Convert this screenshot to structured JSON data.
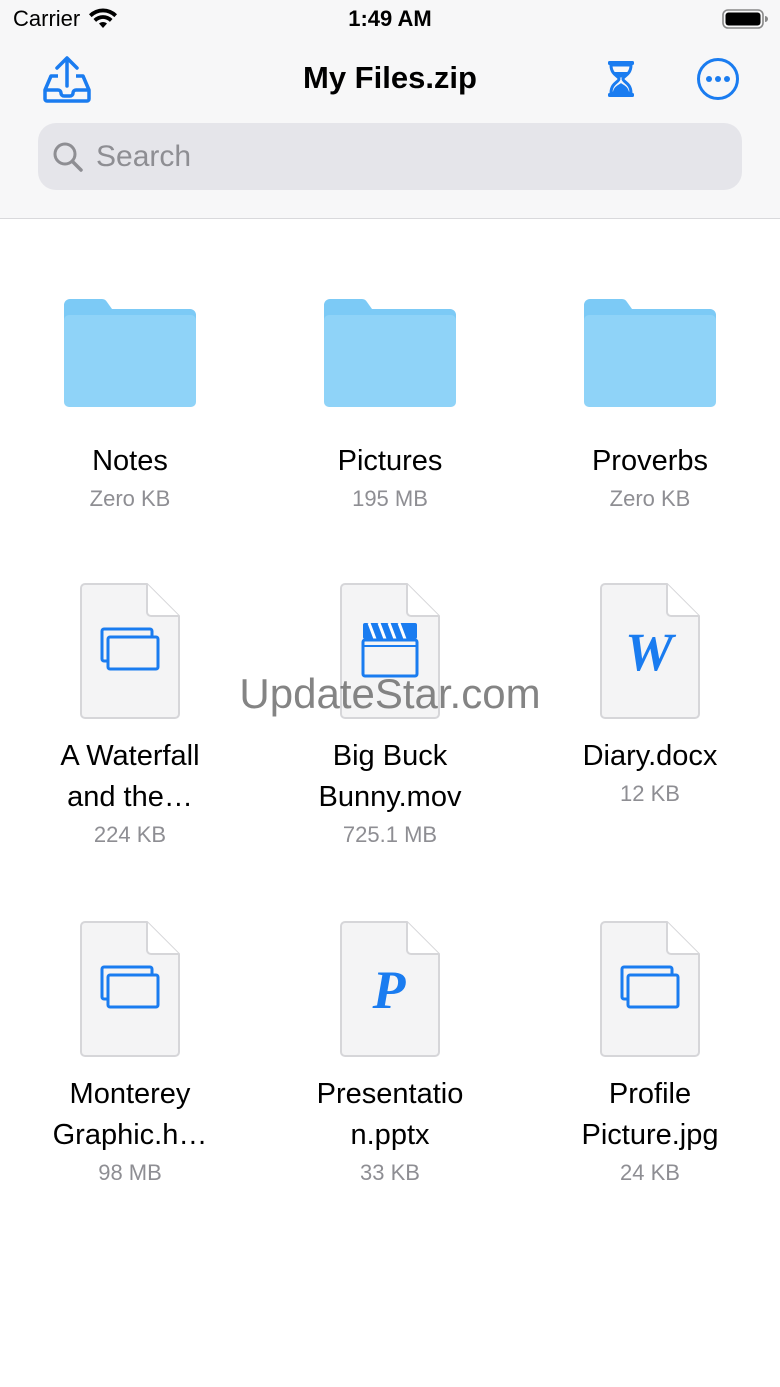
{
  "status_bar": {
    "carrier": "Carrier",
    "time": "1:49 AM"
  },
  "nav": {
    "title": "My Files.zip",
    "left_icon": "upload-tray-icon",
    "right_icons": [
      "hourglass-icon",
      "more-ellipsis-icon"
    ]
  },
  "search": {
    "placeholder": "Search",
    "value": ""
  },
  "items": [
    {
      "name": "Notes",
      "size": "Zero KB",
      "kind": "folder"
    },
    {
      "name": "Pictures",
      "size": "195 MB",
      "kind": "folder"
    },
    {
      "name": "Proverbs",
      "size": "Zero KB",
      "kind": "folder"
    },
    {
      "name": "A Waterfall and the…",
      "name_line1": "A Waterfall",
      "name_line2": "and the…",
      "size": "224 KB",
      "kind": "image"
    },
    {
      "name": "Big Buck Bunny.mov",
      "name_line1": "Big Buck",
      "name_line2": "Bunny.mov",
      "size": "725.1 MB",
      "kind": "video"
    },
    {
      "name": "Diary.docx",
      "size": "12 KB",
      "kind": "word"
    },
    {
      "name": "Monterey Graphic.h…",
      "name_line1": "Monterey",
      "name_line2": "Graphic.h…",
      "size": "98 MB",
      "kind": "image"
    },
    {
      "name": "Presentation.pptx",
      "name_line1": "Presentatio",
      "name_line2": "n.pptx",
      "size": "33 KB",
      "kind": "powerpoint"
    },
    {
      "name": "Profile Picture.jpg",
      "name_line1": "Profile",
      "name_line2": "Picture.jpg",
      "size": "24 KB",
      "kind": "image"
    }
  ],
  "watermark": "UpdateStar.com",
  "colors": {
    "accent": "#1a7cf0",
    "folder": "#8fd3f8",
    "folder_tab": "#7ccaf6",
    "secondary_text": "#8e8e93",
    "search_bg": "#e5e5ea"
  }
}
